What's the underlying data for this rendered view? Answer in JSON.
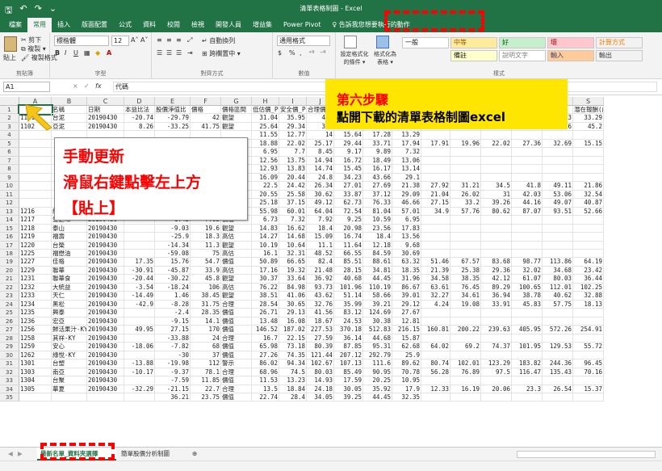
{
  "app": {
    "title": "清單表格制圖 - Excel",
    "quick_access": [
      "🖫",
      "↶",
      "↷",
      "⌄"
    ]
  },
  "tabs": [
    "檔案",
    "常用",
    "插入",
    "版面配置",
    "公式",
    "資料",
    "校閱",
    "檢視",
    "開發人員",
    "增益集",
    "Power Pivot",
    "♀ 告訴我您想要執行的動作"
  ],
  "ribbon": {
    "clipboard": {
      "paste": "貼上",
      "cut": "剪下",
      "copy": "複製 ▾",
      "format_painter": "複製格式",
      "label": "剪貼簿"
    },
    "font": {
      "name": "標楷體",
      "size": "12",
      "bold": "B",
      "italic": "I",
      "underline": "U",
      "grow": "A˄",
      "shrink": "A˅",
      "label": "字型"
    },
    "alignment": {
      "wrap": "自動換列",
      "merge": "跨欄置中 ▾",
      "label": "對齊方式"
    },
    "number": {
      "format": "通用格式",
      "currency": "$",
      "percent": "%",
      "comma": ",",
      "inc": "⁺⁰",
      "dec": "⁻⁰",
      "label": "數值"
    },
    "styles": {
      "conditional": "設定格式化的條件 ▾",
      "as_table": "格式化為表格 ▾",
      "label": "樣式",
      "cells": [
        {
          "text": "一般",
          "bg": "#ffffff",
          "fg": "#222222"
        },
        {
          "text": "中等",
          "bg": "#ffeb9c",
          "fg": "#9c5700"
        },
        {
          "text": "好",
          "bg": "#c6efce",
          "fg": "#006100"
        },
        {
          "text": "壞",
          "bg": "#ffc7ce",
          "fg": "#9c0006"
        },
        {
          "text": "計算方式",
          "bg": "#f2f2f2",
          "fg": "#fa7d00"
        },
        {
          "text": "備註",
          "bg": "#ffffcc",
          "fg": "#222222"
        },
        {
          "text": "說明文字",
          "bg": "#ffffff",
          "fg": "#7f7f7f"
        },
        {
          "text": "輸入",
          "bg": "#ffcc99",
          "fg": "#3f3f76"
        },
        {
          "text": "輸出",
          "bg": "#f2f2f2",
          "fg": "#3f3f3f"
        }
      ]
    }
  },
  "formula_bar": {
    "name_box": "A1",
    "fx": "fx",
    "cancel": "×",
    "enter": "✓",
    "value": "代碼"
  },
  "columns": [
    "A",
    "B",
    "C",
    "D",
    "E",
    "F",
    "G",
    "H",
    "I",
    "J",
    "K",
    "L",
    "M",
    "N",
    "O",
    "P",
    "Q",
    "R",
    "S"
  ],
  "rows": [
    {
      "n": "1",
      "cells": [
        "",
        "名稱",
        "日期",
        "本益比法",
        "股價淨值比",
        "價格",
        "價格區間",
        "低估價_PE",
        "安全價_PE",
        "合理價",
        "",
        "",
        "",
        "",
        "",
        "",
        "",
        "低價_PB",
        "潛在報酬(成長)"
      ]
    },
    {
      "n": "2",
      "cells": [
        "1101",
        "台泥",
        "20190430",
        "-20.74",
        "-29.79",
        "42",
        "觀望",
        "31.04",
        "35.95",
        "40.",
        "",
        "",
        "",
        "",
        "",
        "",
        "",
        "122.13",
        "33.29"
      ]
    },
    {
      "n": "3",
      "cells": [
        "1102",
        "亞泥",
        "20190430",
        "8.26",
        "-33.25",
        "41.75",
        "觀望",
        "25.64",
        "29.34",
        "33.",
        "",
        "",
        "",
        "",
        "",
        "",
        "",
        "98.66",
        "45.2"
      ]
    },
    {
      "n": "4",
      "cells": [
        "",
        "",
        "",
        "",
        "",
        "",
        "",
        "11.55",
        "12.77",
        "14",
        "15.64",
        "17.28",
        "13.29",
        "",
        "",
        "",
        "",
        "",
        ""
      ]
    },
    {
      "n": "5",
      "cells": [
        "",
        "",
        "",
        "",
        "",
        "",
        "",
        "18.88",
        "22.02",
        "25.17",
        "29.44",
        "33.71",
        "17.94",
        "17.91",
        "19.96",
        "22.02",
        "27.36",
        "32.69",
        "15.15"
      ]
    },
    {
      "n": "6",
      "cells": [
        "",
        "",
        "",
        "",
        "",
        "",
        "",
        "6.95",
        "7.7",
        "8.45",
        "9.17",
        "9.89",
        "7.32",
        "",
        "",
        "",
        "",
        "",
        ""
      ]
    },
    {
      "n": "7",
      "cells": [
        "",
        "",
        "",
        "",
        "",
        "",
        "",
        "12.56",
        "13.75",
        "14.94",
        "16.72",
        "18.49",
        "13.06",
        "",
        "",
        "",
        "",
        "",
        ""
      ]
    },
    {
      "n": "8",
      "cells": [
        "",
        "",
        "",
        "",
        "",
        "",
        "",
        "12.93",
        "13.83",
        "14.74",
        "15.45",
        "16.17",
        "13.14",
        "",
        "",
        "",
        "",
        "",
        ""
      ]
    },
    {
      "n": "9",
      "cells": [
        "",
        "",
        "",
        "",
        "",
        "",
        "",
        "16.09",
        "20.44",
        "24.8",
        "34.23",
        "43.66",
        "29.1",
        "",
        "",
        "",
        "",
        "",
        ""
      ]
    },
    {
      "n": "10",
      "cells": [
        "",
        "",
        "",
        "",
        "",
        "",
        "",
        "22.5",
        "24.42",
        "26.34",
        "27.01",
        "27.69",
        "21.38",
        "27.92",
        "31.21",
        "34.5",
        "41.8",
        "49.11",
        "21.86"
      ]
    },
    {
      "n": "11",
      "cells": [
        "",
        "",
        "",
        "",
        "",
        "",
        "",
        "20.55",
        "25.58",
        "30.62",
        "33.87",
        "37.12",
        "29.09",
        "21.04",
        "26.02",
        "31",
        "42.03",
        "53.06",
        "32.54"
      ]
    },
    {
      "n": "12",
      "cells": [
        "",
        "",
        "",
        "",
        "",
        "",
        "",
        "25.18",
        "37.15",
        "49.12",
        "62.73",
        "76.33",
        "46.66",
        "27.15",
        "33.2",
        "39.26",
        "44.16",
        "49.07",
        "40.87"
      ]
    },
    {
      "n": "13",
      "cells": [
        "1216",
        "統一",
        "20190430",
        "-28.26",
        "-22.33",
        "73.4",
        "合理",
        "55.98",
        "60.01",
        "64.04",
        "72.54",
        "81.04",
        "57.01",
        "34.9",
        "57.76",
        "80.62",
        "87.07",
        "93.51",
        "52.66"
      ]
    },
    {
      "n": "14",
      "cells": [
        "1217",
        "愛之味",
        "20190430",
        "",
        "-1.42",
        "7.05",
        "價值",
        "6.73",
        "7.32",
        "7.92",
        "9.25",
        "10.59",
        "6.95",
        "",
        "",
        "",
        "",
        "",
        ""
      ]
    },
    {
      "n": "15",
      "cells": [
        "1218",
        "泰山",
        "20190430",
        "",
        "-9.03",
        "19.6",
        "觀望",
        "14.83",
        "16.62",
        "18.4",
        "20.98",
        "23.56",
        "17.83",
        "",
        "",
        "",
        "",
        "",
        ""
      ]
    },
    {
      "n": "16",
      "cells": [
        "1219",
        "福壽",
        "20190430",
        "",
        "-25.9",
        "18.3",
        "高估",
        "14.27",
        "14.68",
        "15.09",
        "16.74",
        "18.4",
        "13.56",
        "",
        "",
        "",
        "",
        "",
        ""
      ]
    },
    {
      "n": "17",
      "cells": [
        "1220",
        "台榮",
        "20190430",
        "",
        "-14.34",
        "11.3",
        "觀望",
        "10.19",
        "10.64",
        "11.1",
        "11.64",
        "12.18",
        "9.68",
        "",
        "",
        "",
        "",
        "",
        ""
      ]
    },
    {
      "n": "18",
      "cells": [
        "1225",
        "福懋油",
        "20190430",
        "",
        "-59.08",
        "75",
        "高估",
        "16.1",
        "32.31",
        "48.52",
        "66.55",
        "84.59",
        "30.69",
        "",
        "",
        "",
        "",
        "",
        ""
      ]
    },
    {
      "n": "19",
      "cells": [
        "1227",
        "佳格",
        "20190430",
        "17.35",
        "15.76",
        "54.7",
        "價值",
        "50.89",
        "66.65",
        "82.4",
        "85.51",
        "88.61",
        "63.32",
        "51.46",
        "67.57",
        "83.68",
        "98.77",
        "113.86",
        "64.19"
      ]
    },
    {
      "n": "20",
      "cells": [
        "1229",
        "聯華",
        "20190430",
        "-30.91",
        "-45.87",
        "33.9",
        "高估",
        "17.16",
        "19.32",
        "21.48",
        "28.15",
        "34.81",
        "18.35",
        "21.39",
        "25.38",
        "29.36",
        "32.02",
        "34.68",
        "23.42"
      ]
    },
    {
      "n": "21",
      "cells": [
        "1231",
        "聯華食",
        "20190430",
        "-20.44",
        "-30.22",
        "45.8",
        "觀望",
        "30.37",
        "33.64",
        "36.92",
        "40.68",
        "44.45",
        "31.96",
        "34.58",
        "38.35",
        "42.12",
        "61.07",
        "80.03",
        "36.44"
      ]
    },
    {
      "n": "22",
      "cells": [
        "1232",
        "大統益",
        "20190430",
        "-3.54",
        "-18.24",
        "106",
        "高估",
        "76.22",
        "84.98",
        "93.73",
        "101.96",
        "110.19",
        "86.67",
        "63.61",
        "76.45",
        "89.29",
        "100.65",
        "112.01",
        "102.25"
      ]
    },
    {
      "n": "23",
      "cells": [
        "1233",
        "天仁",
        "20190430",
        "-14.49",
        "1.46",
        "38.45",
        "觀望",
        "38.51",
        "41.06",
        "43.62",
        "51.14",
        "58.66",
        "39.01",
        "32.27",
        "34.61",
        "36.94",
        "38.78",
        "40.62",
        "32.88"
      ]
    },
    {
      "n": "24",
      "cells": [
        "1234",
        "黑松",
        "20190430",
        "-42.9",
        "-8.28",
        "31.75",
        "合理",
        "28.54",
        "30.65",
        "32.76",
        "35.99",
        "39.21",
        "29.12",
        "4.24",
        "19.08",
        "33.91",
        "45.83",
        "57.75",
        "18.13"
      ]
    },
    {
      "n": "25",
      "cells": [
        "1235",
        "興泰",
        "20190430",
        "",
        "-2.4",
        "28.35",
        "價值",
        "26.71",
        "29.13",
        "41.56",
        "83.12",
        "124.69",
        "27.67",
        "",
        "",
        "",
        "",
        "",
        ""
      ]
    },
    {
      "n": "26",
      "cells": [
        "1236",
        "宏亞",
        "20190430",
        "",
        "-9.15",
        "14.1",
        "價值",
        "13.48",
        "16.08",
        "18.67",
        "24.53",
        "30.38",
        "12.81",
        "",
        "",
        "",
        "",
        "",
        ""
      ]
    },
    {
      "n": "27",
      "cells": [
        "1256",
        "鮮活果汁-KY",
        "20190430",
        "49.95",
        "27.15",
        "170",
        "價值",
        "146.52",
        "187.02",
        "227.53",
        "370.18",
        "512.83",
        "216.15",
        "160.81",
        "200.22",
        "239.63",
        "405.95",
        "572.26",
        "254.91"
      ]
    },
    {
      "n": "28",
      "cells": [
        "1258",
        "其祥-KY",
        "20190430",
        "",
        "-33.88",
        "24",
        "合理",
        "16.7",
        "22.15",
        "27.59",
        "36.14",
        "44.68",
        "15.87",
        "",
        "",
        "",
        "",
        "",
        ""
      ]
    },
    {
      "n": "29",
      "cells": [
        "1259",
        "安心",
        "20190430",
        "-18.06",
        "-7.82",
        "68",
        "價值",
        "65.98",
        "73.18",
        "80.39",
        "87.85",
        "95.31",
        "62.68",
        "64.02",
        "69.2",
        "74.37",
        "101.95",
        "129.53",
        "55.72"
      ]
    },
    {
      "n": "30",
      "cells": [
        "1262",
        "綠悅-KY",
        "20190430",
        "",
        "-30",
        "37",
        "價值",
        "27.26",
        "74.35",
        "121.44",
        "207.12",
        "292.79",
        "25.9",
        "",
        "",
        "",
        "",
        "",
        ""
      ]
    },
    {
      "n": "31",
      "cells": [
        "1301",
        "台塑",
        "20190430",
        "-13.88",
        "-19.98",
        "112",
        "警示",
        "86.02",
        "94.34",
        "102.67",
        "107.13",
        "111.6",
        "89.62",
        "80.74",
        "102.01",
        "123.29",
        "183.82",
        "244.36",
        "96.45"
      ]
    },
    {
      "n": "32",
      "cells": [
        "1303",
        "南亞",
        "20190430",
        "-10.17",
        "-9.37",
        "78.1",
        "合理",
        "68.96",
        "74.5",
        "80.03",
        "85.49",
        "90.95",
        "70.78",
        "56.28",
        "76.89",
        "97.5",
        "116.47",
        "135.43",
        "70.16"
      ]
    },
    {
      "n": "33",
      "cells": [
        "1304",
        "台聚",
        "20190430",
        "",
        "-7.59",
        "11.85",
        "價值",
        "11.53",
        "13.23",
        "14.93",
        "17.59",
        "20.25",
        "10.95",
        "",
        "",
        "",
        "",
        "",
        ""
      ]
    },
    {
      "n": "34",
      "cells": [
        "1305",
        "華夏",
        "20190430",
        "-32.29",
        "-21.15",
        "22.7",
        "合理",
        "13.5",
        "18.84",
        "24.18",
        "30.05",
        "35.92",
        "17.9",
        "12.33",
        "16.19",
        "20.06",
        "23.3",
        "26.54",
        "15.37"
      ]
    },
    {
      "n": "35",
      "cells": [
        "",
        "",
        "",
        "",
        "36.21",
        "23.75",
        "價值",
        "22.74",
        "28.4",
        "34.05",
        "39.25",
        "44.45",
        "32.35",
        "",
        "",
        "",
        "",
        "",
        ""
      ]
    }
  ],
  "sheets": {
    "active": "最新名單_資料夾選擇",
    "other": "簡單股價分析制圖",
    "add": "⊕"
  },
  "annotations": {
    "callout": {
      "line1": "手動更新",
      "line2": "滑鼠右鍵點擊左上方",
      "line3": "【貼上】"
    },
    "banner": {
      "line1": "第六步驟",
      "line2": "點開下載的清單表格制圖excel"
    }
  },
  "colors": {
    "excel_green": "#217346",
    "annotation_red": "#ff0000",
    "banner_yellow": "#ffe600",
    "arrow_yellow": "#f5c518"
  }
}
